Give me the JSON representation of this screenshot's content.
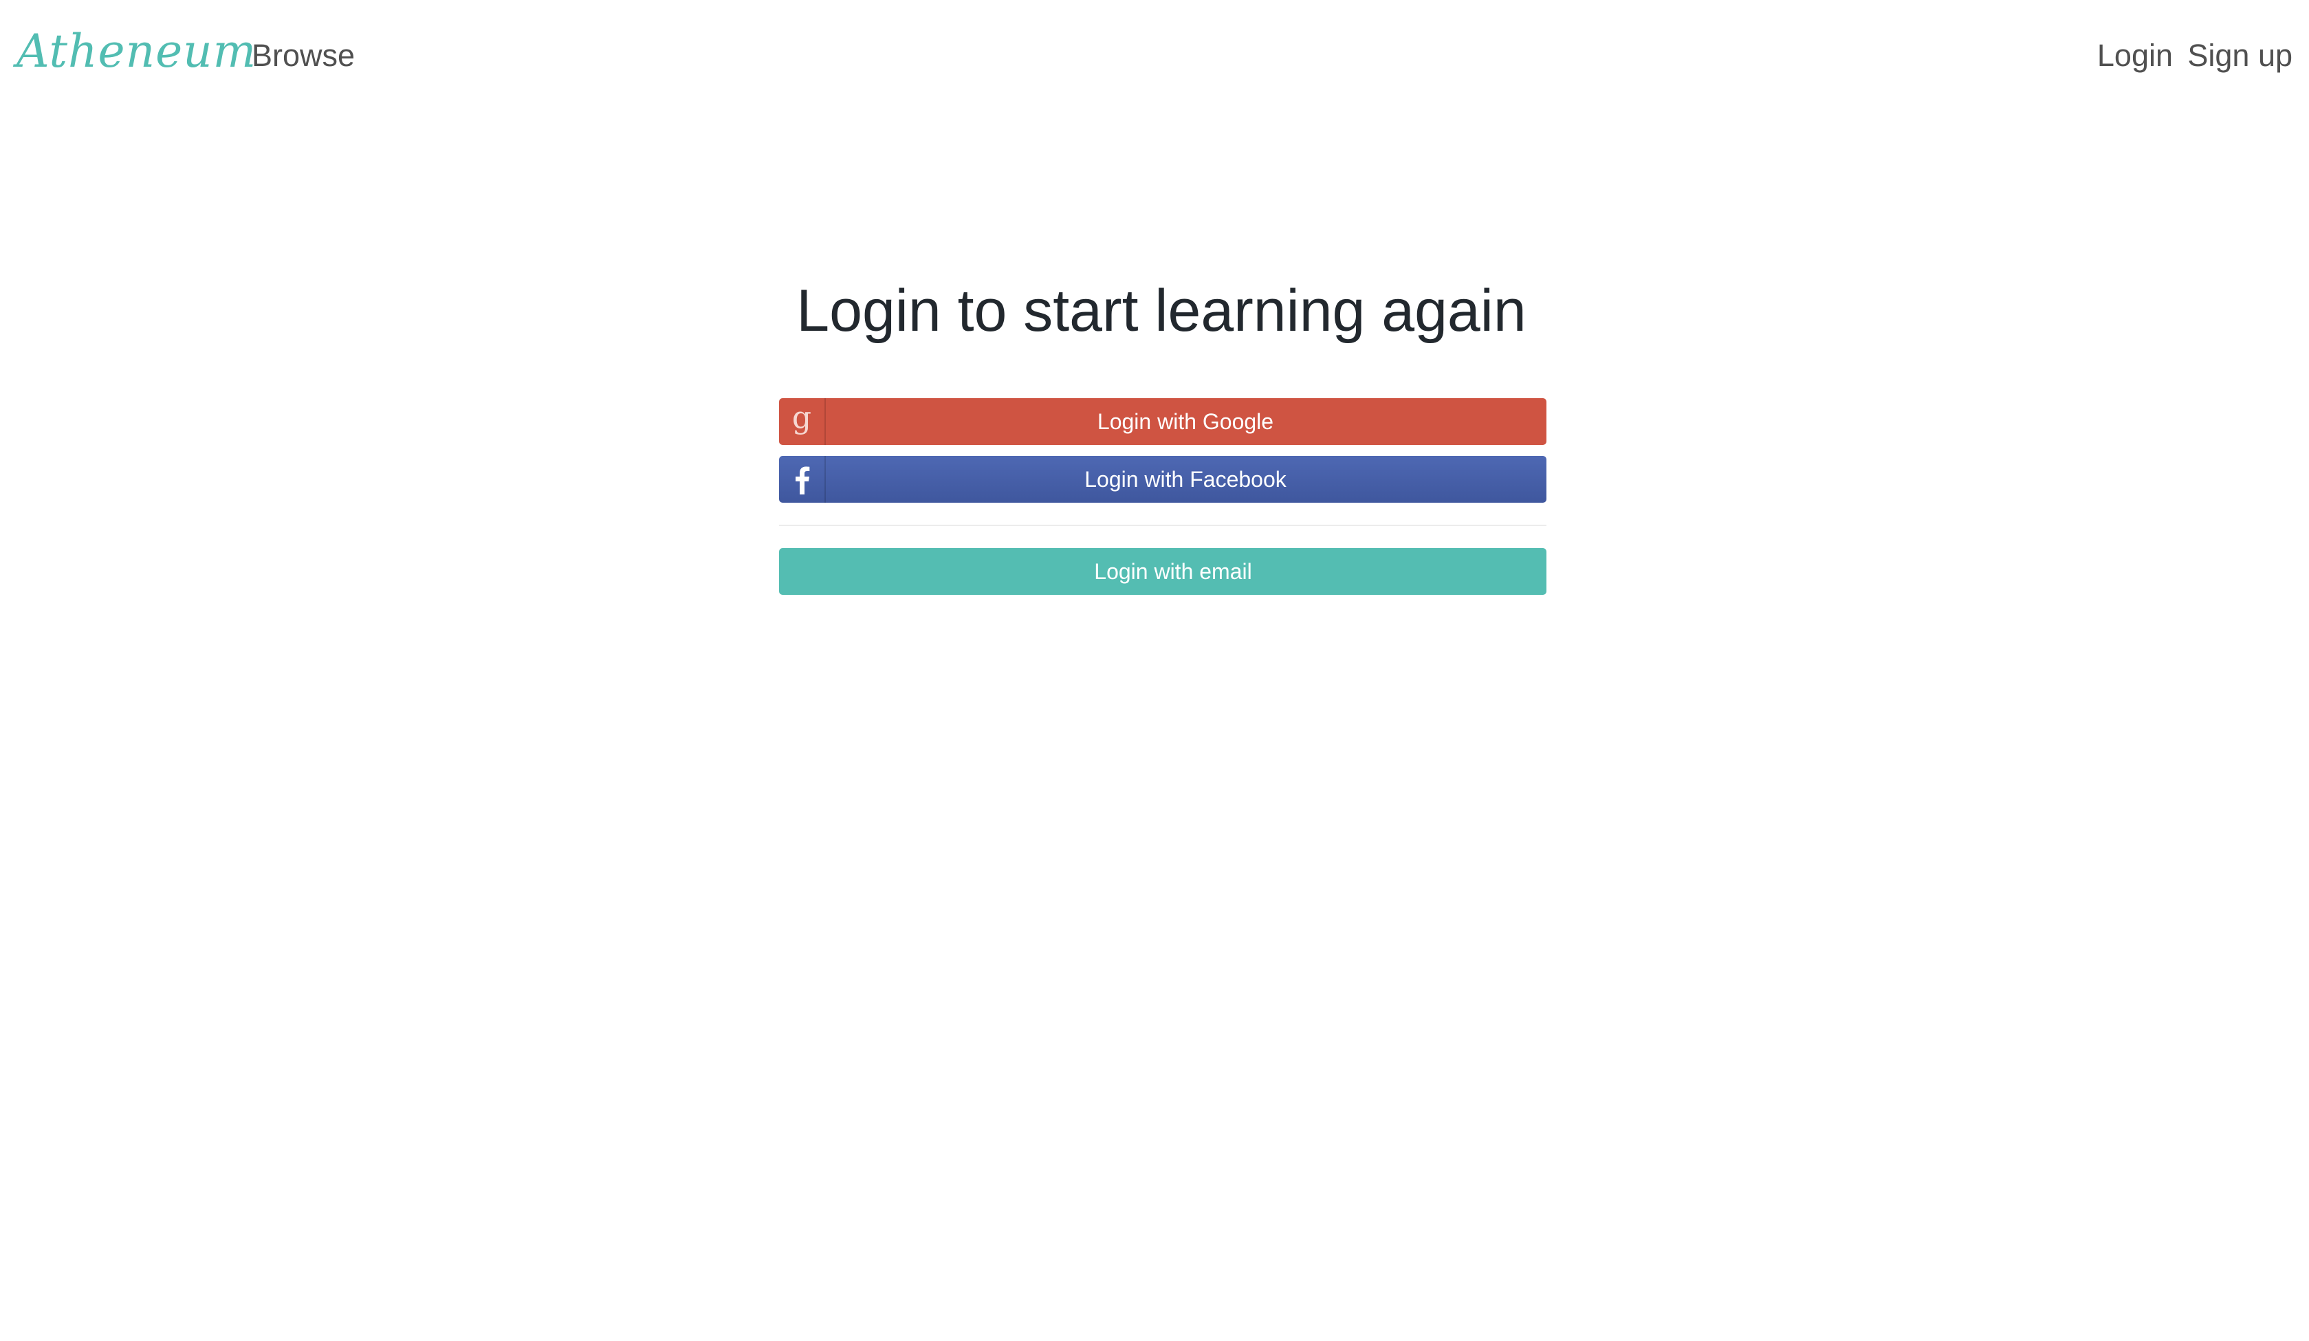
{
  "header": {
    "brand": "Atheneum",
    "browse": "Browse",
    "login": "Login",
    "signup": "Sign up"
  },
  "main": {
    "title": "Login to start learning again",
    "google_button": "Login with Google",
    "facebook_button": "Login with Facebook",
    "email_button": "Login with email"
  },
  "icons": {
    "google": "google-g-icon",
    "facebook": "facebook-f-icon"
  },
  "colors": {
    "brand": "#52bdb2",
    "google": "#cf5442",
    "facebook": "#4661ab",
    "email": "#54bdb2",
    "title_text": "#22282e",
    "nav_text": "#505050"
  }
}
